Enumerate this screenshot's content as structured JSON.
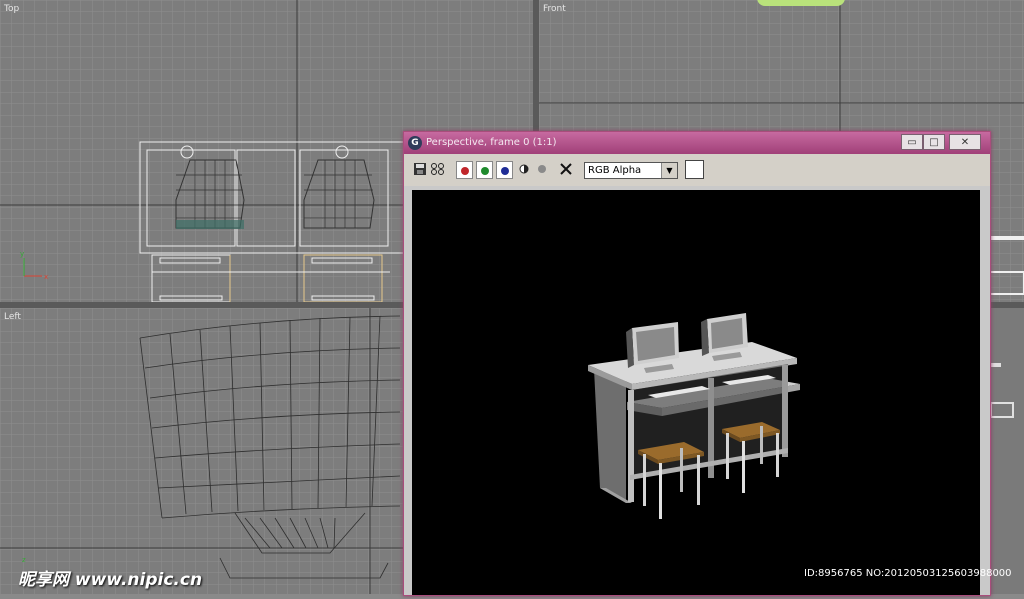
{
  "viewports": {
    "top": {
      "label": "Top"
    },
    "front": {
      "label": "Front"
    },
    "left": {
      "label": "Left"
    }
  },
  "render_window": {
    "title": "Perspective, frame 0 (1:1)",
    "toolbar": {
      "save_icon": "save-icon",
      "clone_icon": "clone-icon",
      "channels": [
        {
          "name": "red-channel",
          "color": "#c0262b"
        },
        {
          "name": "green-channel",
          "color": "#1f8a2d"
        },
        {
          "name": "blue-channel",
          "color": "#1f2d96"
        }
      ],
      "mono_icon": "monochrome-icon",
      "clear_icon": "clear-icon",
      "channel_select": "RGB Alpha"
    },
    "window_buttons": {
      "minimize": "▭",
      "maximize": "□",
      "close": "✕"
    }
  },
  "watermark": {
    "brand": "昵享网 www.nipic.cn",
    "id_text": "ID:8956765 NO:20120503125603988000"
  },
  "colors": {
    "title_bar": "#b14f89",
    "viewport_bg": "#7d7d7d",
    "desk_top": "#d9d9d9",
    "stool_seat": "#9a6b2c"
  }
}
